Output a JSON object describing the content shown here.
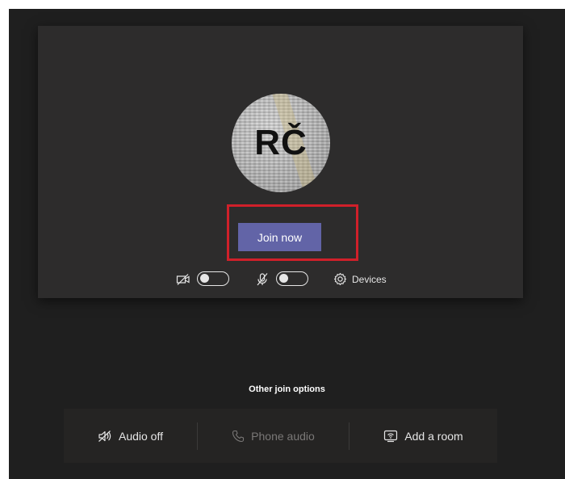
{
  "preview": {
    "avatar_initials": "RČ"
  },
  "join": {
    "label": "Join now"
  },
  "controls": {
    "camera": {
      "icon": "camera-off-icon",
      "on": false
    },
    "mic": {
      "icon": "mic-off-icon",
      "on": false
    },
    "devices": {
      "icon": "gear-icon",
      "label": "Devices"
    }
  },
  "other_options": {
    "title": "Other join options",
    "items": [
      {
        "icon": "speaker-off-icon",
        "label": "Audio off",
        "enabled": true
      },
      {
        "icon": "phone-icon",
        "label": "Phone audio",
        "enabled": false
      },
      {
        "icon": "cast-room-icon",
        "label": "Add a room",
        "enabled": true
      }
    ]
  },
  "colors": {
    "accent": "#6264a7",
    "highlight": "#d0202a",
    "card_bg": "#2d2c2c",
    "page_bg": "#1f1f1f",
    "disabled_text": "#7a7877"
  }
}
